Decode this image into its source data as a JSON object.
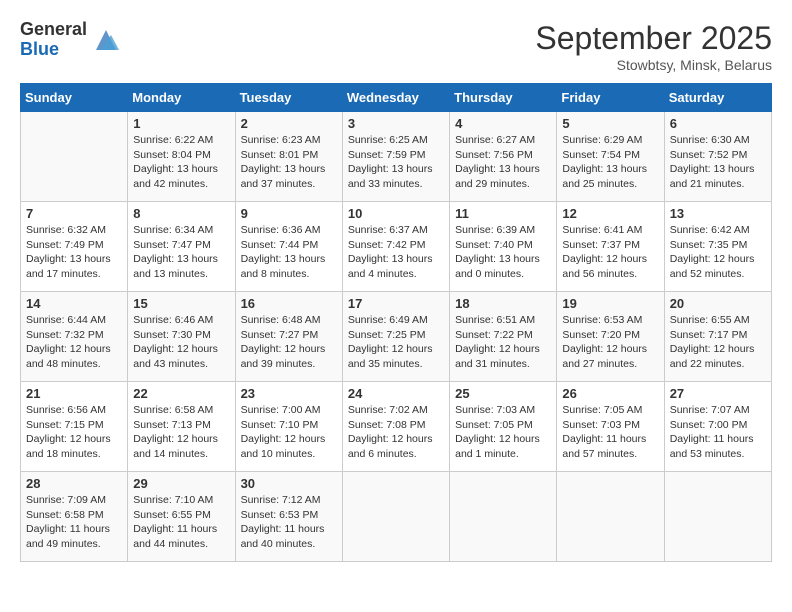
{
  "header": {
    "logo_general": "General",
    "logo_blue": "Blue",
    "month": "September 2025",
    "location": "Stowbtsy, Minsk, Belarus"
  },
  "weekdays": [
    "Sunday",
    "Monday",
    "Tuesday",
    "Wednesday",
    "Thursday",
    "Friday",
    "Saturday"
  ],
  "weeks": [
    [
      {
        "day": "",
        "sunrise": "",
        "sunset": "",
        "daylight": ""
      },
      {
        "day": "1",
        "sunrise": "Sunrise: 6:22 AM",
        "sunset": "Sunset: 8:04 PM",
        "daylight": "Daylight: 13 hours and 42 minutes."
      },
      {
        "day": "2",
        "sunrise": "Sunrise: 6:23 AM",
        "sunset": "Sunset: 8:01 PM",
        "daylight": "Daylight: 13 hours and 37 minutes."
      },
      {
        "day": "3",
        "sunrise": "Sunrise: 6:25 AM",
        "sunset": "Sunset: 7:59 PM",
        "daylight": "Daylight: 13 hours and 33 minutes."
      },
      {
        "day": "4",
        "sunrise": "Sunrise: 6:27 AM",
        "sunset": "Sunset: 7:56 PM",
        "daylight": "Daylight: 13 hours and 29 minutes."
      },
      {
        "day": "5",
        "sunrise": "Sunrise: 6:29 AM",
        "sunset": "Sunset: 7:54 PM",
        "daylight": "Daylight: 13 hours and 25 minutes."
      },
      {
        "day": "6",
        "sunrise": "Sunrise: 6:30 AM",
        "sunset": "Sunset: 7:52 PM",
        "daylight": "Daylight: 13 hours and 21 minutes."
      }
    ],
    [
      {
        "day": "7",
        "sunrise": "Sunrise: 6:32 AM",
        "sunset": "Sunset: 7:49 PM",
        "daylight": "Daylight: 13 hours and 17 minutes."
      },
      {
        "day": "8",
        "sunrise": "Sunrise: 6:34 AM",
        "sunset": "Sunset: 7:47 PM",
        "daylight": "Daylight: 13 hours and 13 minutes."
      },
      {
        "day": "9",
        "sunrise": "Sunrise: 6:36 AM",
        "sunset": "Sunset: 7:44 PM",
        "daylight": "Daylight: 13 hours and 8 minutes."
      },
      {
        "day": "10",
        "sunrise": "Sunrise: 6:37 AM",
        "sunset": "Sunset: 7:42 PM",
        "daylight": "Daylight: 13 hours and 4 minutes."
      },
      {
        "day": "11",
        "sunrise": "Sunrise: 6:39 AM",
        "sunset": "Sunset: 7:40 PM",
        "daylight": "Daylight: 13 hours and 0 minutes."
      },
      {
        "day": "12",
        "sunrise": "Sunrise: 6:41 AM",
        "sunset": "Sunset: 7:37 PM",
        "daylight": "Daylight: 12 hours and 56 minutes."
      },
      {
        "day": "13",
        "sunrise": "Sunrise: 6:42 AM",
        "sunset": "Sunset: 7:35 PM",
        "daylight": "Daylight: 12 hours and 52 minutes."
      }
    ],
    [
      {
        "day": "14",
        "sunrise": "Sunrise: 6:44 AM",
        "sunset": "Sunset: 7:32 PM",
        "daylight": "Daylight: 12 hours and 48 minutes."
      },
      {
        "day": "15",
        "sunrise": "Sunrise: 6:46 AM",
        "sunset": "Sunset: 7:30 PM",
        "daylight": "Daylight: 12 hours and 43 minutes."
      },
      {
        "day": "16",
        "sunrise": "Sunrise: 6:48 AM",
        "sunset": "Sunset: 7:27 PM",
        "daylight": "Daylight: 12 hours and 39 minutes."
      },
      {
        "day": "17",
        "sunrise": "Sunrise: 6:49 AM",
        "sunset": "Sunset: 7:25 PM",
        "daylight": "Daylight: 12 hours and 35 minutes."
      },
      {
        "day": "18",
        "sunrise": "Sunrise: 6:51 AM",
        "sunset": "Sunset: 7:22 PM",
        "daylight": "Daylight: 12 hours and 31 minutes."
      },
      {
        "day": "19",
        "sunrise": "Sunrise: 6:53 AM",
        "sunset": "Sunset: 7:20 PM",
        "daylight": "Daylight: 12 hours and 27 minutes."
      },
      {
        "day": "20",
        "sunrise": "Sunrise: 6:55 AM",
        "sunset": "Sunset: 7:17 PM",
        "daylight": "Daylight: 12 hours and 22 minutes."
      }
    ],
    [
      {
        "day": "21",
        "sunrise": "Sunrise: 6:56 AM",
        "sunset": "Sunset: 7:15 PM",
        "daylight": "Daylight: 12 hours and 18 minutes."
      },
      {
        "day": "22",
        "sunrise": "Sunrise: 6:58 AM",
        "sunset": "Sunset: 7:13 PM",
        "daylight": "Daylight: 12 hours and 14 minutes."
      },
      {
        "day": "23",
        "sunrise": "Sunrise: 7:00 AM",
        "sunset": "Sunset: 7:10 PM",
        "daylight": "Daylight: 12 hours and 10 minutes."
      },
      {
        "day": "24",
        "sunrise": "Sunrise: 7:02 AM",
        "sunset": "Sunset: 7:08 PM",
        "daylight": "Daylight: 12 hours and 6 minutes."
      },
      {
        "day": "25",
        "sunrise": "Sunrise: 7:03 AM",
        "sunset": "Sunset: 7:05 PM",
        "daylight": "Daylight: 12 hours and 1 minute."
      },
      {
        "day": "26",
        "sunrise": "Sunrise: 7:05 AM",
        "sunset": "Sunset: 7:03 PM",
        "daylight": "Daylight: 11 hours and 57 minutes."
      },
      {
        "day": "27",
        "sunrise": "Sunrise: 7:07 AM",
        "sunset": "Sunset: 7:00 PM",
        "daylight": "Daylight: 11 hours and 53 minutes."
      }
    ],
    [
      {
        "day": "28",
        "sunrise": "Sunrise: 7:09 AM",
        "sunset": "Sunset: 6:58 PM",
        "daylight": "Daylight: 11 hours and 49 minutes."
      },
      {
        "day": "29",
        "sunrise": "Sunrise: 7:10 AM",
        "sunset": "Sunset: 6:55 PM",
        "daylight": "Daylight: 11 hours and 44 minutes."
      },
      {
        "day": "30",
        "sunrise": "Sunrise: 7:12 AM",
        "sunset": "Sunset: 6:53 PM",
        "daylight": "Daylight: 11 hours and 40 minutes."
      },
      {
        "day": "",
        "sunrise": "",
        "sunset": "",
        "daylight": ""
      },
      {
        "day": "",
        "sunrise": "",
        "sunset": "",
        "daylight": ""
      },
      {
        "day": "",
        "sunrise": "",
        "sunset": "",
        "daylight": ""
      },
      {
        "day": "",
        "sunrise": "",
        "sunset": "",
        "daylight": ""
      }
    ]
  ]
}
